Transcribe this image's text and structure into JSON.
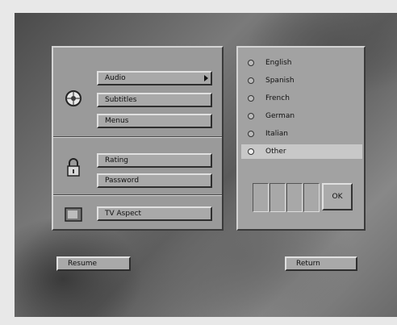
{
  "left_panel": {
    "audio_label": "Audio",
    "subtitles_label": "Subtitles",
    "menus_label": "Menus",
    "rating_label": "Rating",
    "password_label": "Password",
    "tv_aspect_label": "TV Aspect"
  },
  "languages": {
    "items": [
      {
        "label": "English"
      },
      {
        "label": "Spanish"
      },
      {
        "label": "French"
      },
      {
        "label": "German"
      },
      {
        "label": "Italian"
      },
      {
        "label": "Other"
      }
    ],
    "selected": "Other",
    "ok_label": "OK"
  },
  "footer": {
    "resume_label": "Resume",
    "return_label": "Return"
  }
}
